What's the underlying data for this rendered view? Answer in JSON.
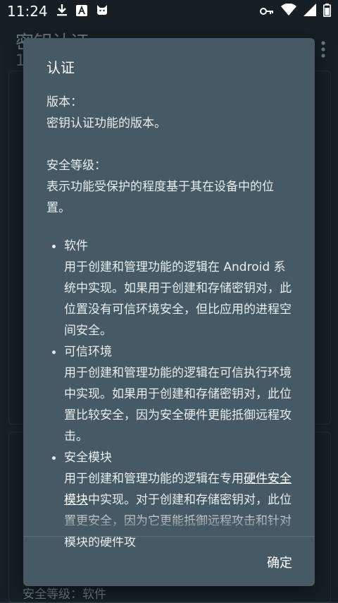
{
  "statusbar": {
    "time": "11:24"
  },
  "background": {
    "title": "密钥认证",
    "subtitle": "1",
    "bottom_text": "安全等级：软件"
  },
  "dialog": {
    "title": "认证",
    "version_label": "版本：",
    "version_desc": "密钥认证功能的版本。",
    "security_label": "安全等级：",
    "security_desc": "表示功能受保护的程度基于其在设备中的位置。",
    "items": [
      {
        "name": "软件",
        "desc": "用于创建和管理功能的逻辑在 Android 系统中实现。如果用于创建和存储密钥对，此位置没有可信环境安全，但比应用的进程空间安全。"
      },
      {
        "name": "可信环境",
        "desc": "用于创建和管理功能的逻辑在可信执行环境中实现。如果用于创建和存储密钥对，此位置比较安全，因为安全硬件更能抵御远程攻击。"
      },
      {
        "name": "安全模块",
        "desc_before": "用于创建和管理功能的逻辑在专用",
        "desc_link": "硬件安全模块",
        "desc_after": "中实现。对于创建和存储密钥对，此位置更安全，因为它更能抵御远程攻击和针对模块的硬件攻"
      }
    ],
    "ok_label": "确定"
  }
}
